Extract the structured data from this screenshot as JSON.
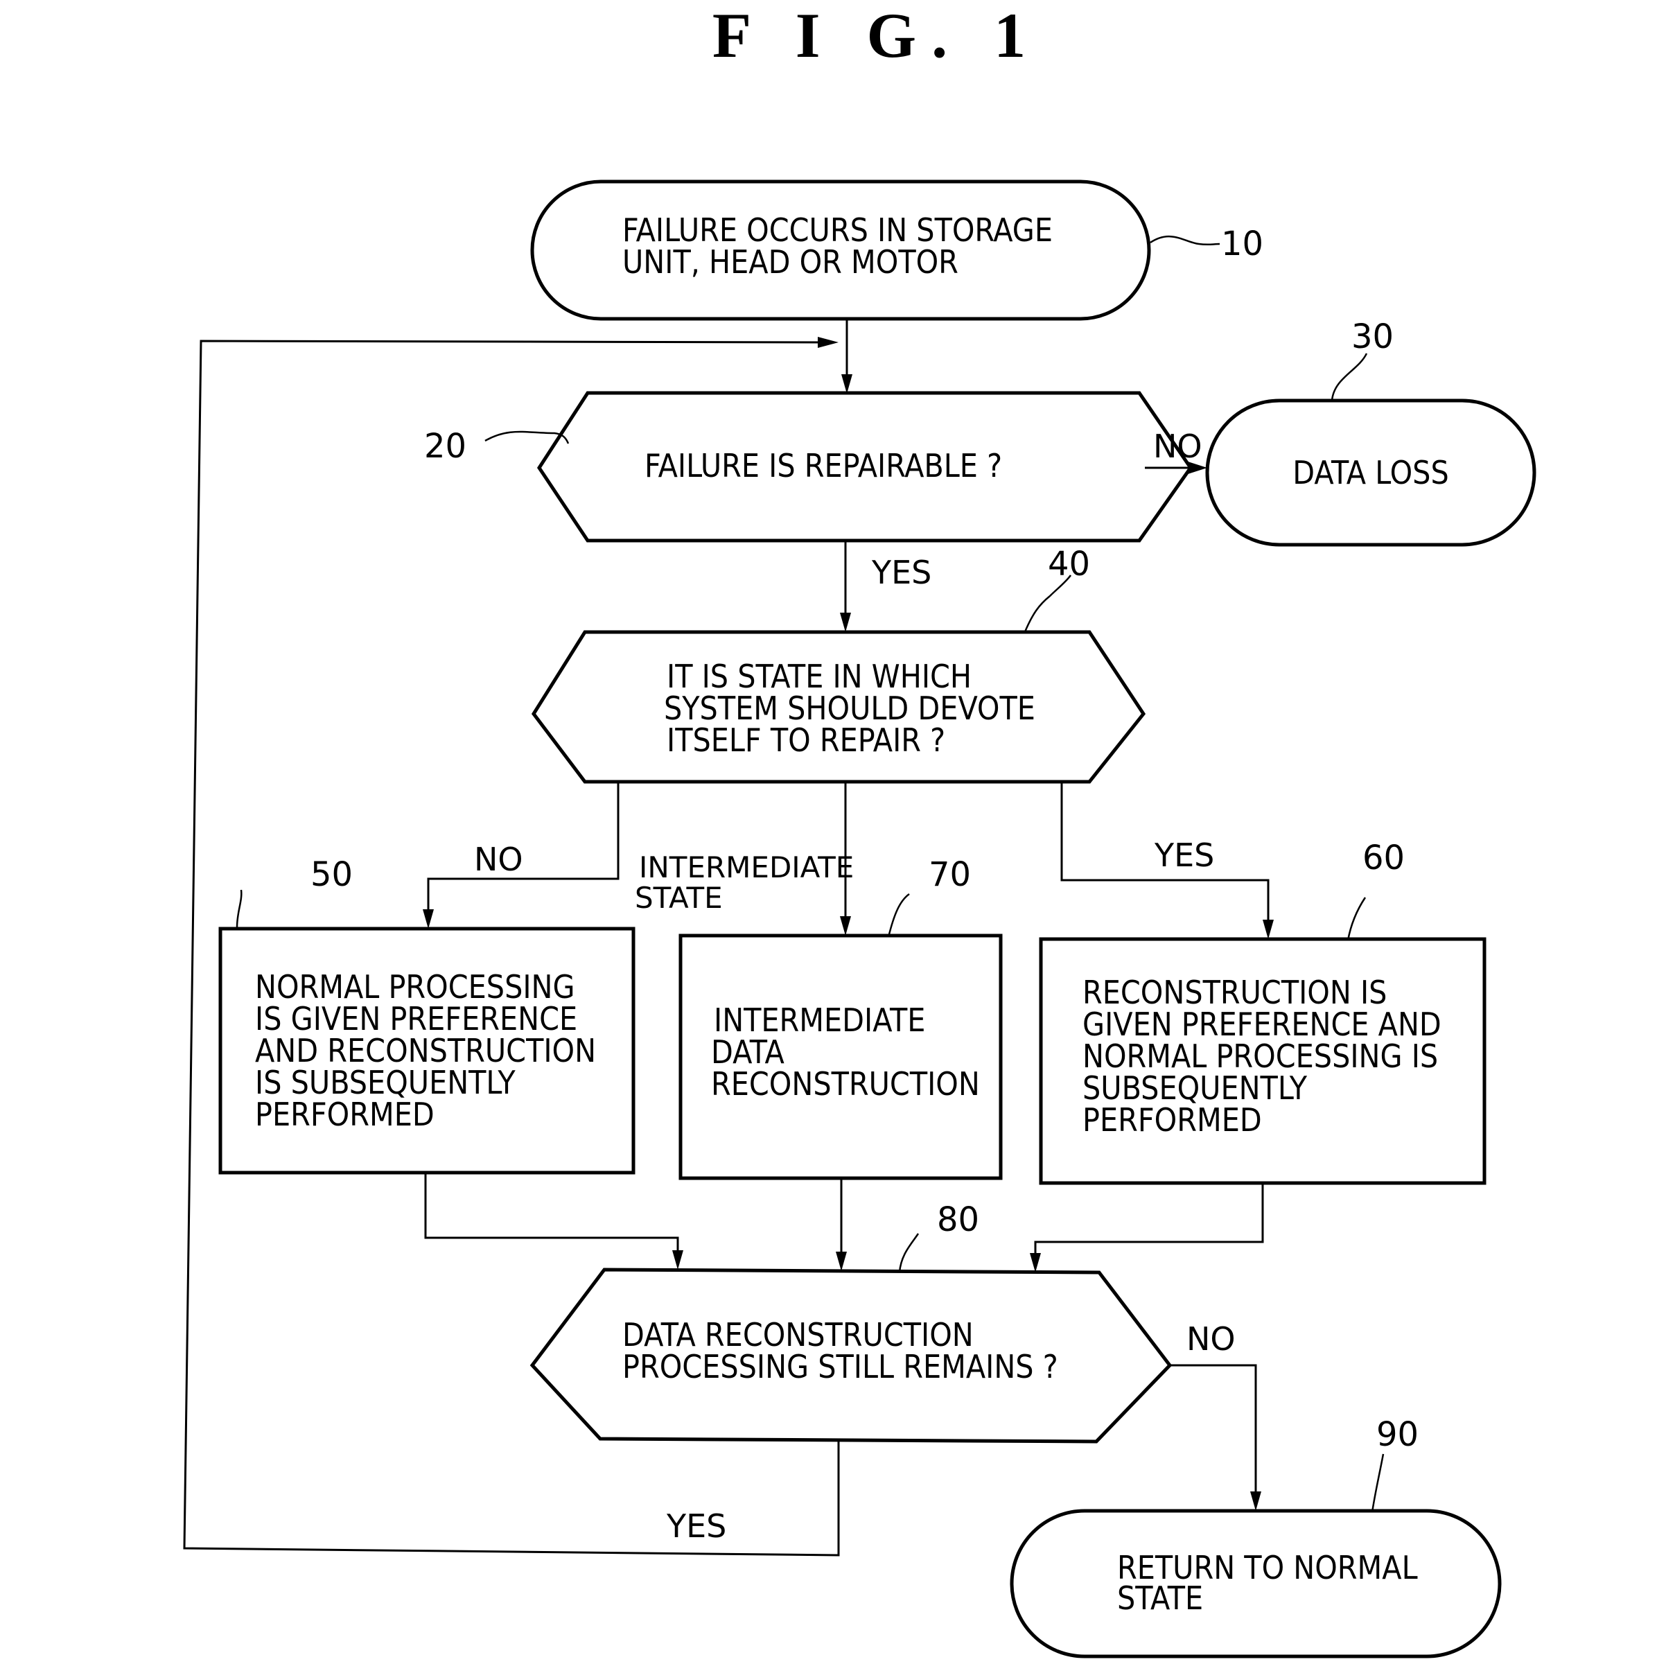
{
  "figure": {
    "title": "F I G. 1"
  },
  "nodes": {
    "n10": {
      "ref": "10",
      "type": "terminal",
      "lines": [
        "FAILURE OCCURS IN STORAGE",
        "UNIT, HEAD OR MOTOR"
      ]
    },
    "n20": {
      "ref": "20",
      "type": "decision",
      "lines": [
        "FAILURE IS REPAIRABLE ?"
      ]
    },
    "n30": {
      "ref": "30",
      "type": "terminal",
      "lines": [
        "DATA LOSS"
      ]
    },
    "n40": {
      "ref": "40",
      "type": "decision",
      "lines": [
        "IT IS STATE IN WHICH",
        "SYSTEM SHOULD DEVOTE",
        "ITSELF TO REPAIR ?"
      ]
    },
    "n50": {
      "ref": "50",
      "type": "process",
      "lines": [
        "NORMAL PROCESSING",
        "IS GIVEN PREFERENCE",
        "AND RECONSTRUCTION",
        "IS SUBSEQUENTLY",
        "PERFORMED"
      ]
    },
    "n70": {
      "ref": "70",
      "type": "process",
      "lines": [
        "INTERMEDIATE",
        "DATA",
        "RECONSTRUCTION"
      ]
    },
    "n60": {
      "ref": "60",
      "type": "process",
      "lines": [
        "RECONSTRUCTION IS",
        "GIVEN PREFERENCE AND",
        "NORMAL PROCESSING IS",
        "SUBSEQUENTLY",
        "PERFORMED"
      ]
    },
    "n80": {
      "ref": "80",
      "type": "decision",
      "lines": [
        "DATA RECONSTRUCTION",
        "PROCESSING STILL REMAINS ?"
      ]
    },
    "n90": {
      "ref": "90",
      "type": "terminal",
      "lines": [
        "RETURN TO NORMAL",
        "STATE"
      ]
    }
  },
  "edges": {
    "e20_30": {
      "from": "20",
      "to": "30",
      "label": "NO"
    },
    "e20_40": {
      "from": "20",
      "to": "40",
      "label": "YES"
    },
    "e40_50": {
      "from": "40",
      "to": "50",
      "label": "NO"
    },
    "e40_70": {
      "from": "40",
      "to": "70",
      "label_lines": [
        "INTERMEDIATE",
        "STATE"
      ]
    },
    "e40_60": {
      "from": "40",
      "to": "60",
      "label": "YES"
    },
    "e80_90": {
      "from": "80",
      "to": "90",
      "label": "NO"
    },
    "e80_20": {
      "from": "80",
      "to": "20",
      "label": "YES"
    }
  }
}
